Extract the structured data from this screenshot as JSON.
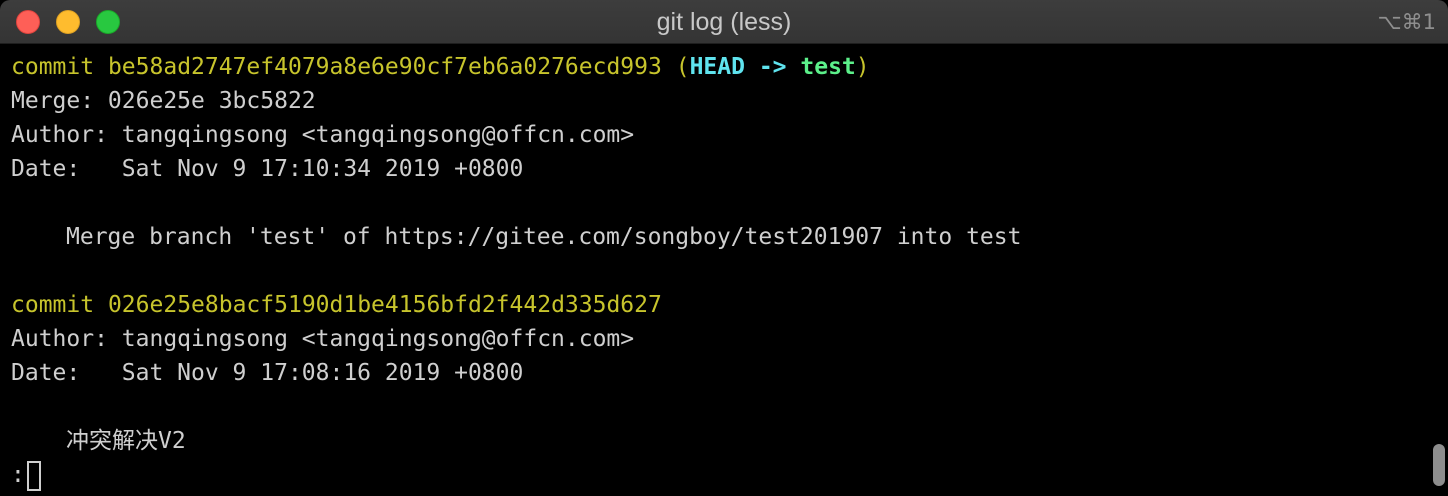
{
  "window": {
    "title": "git log (less)",
    "shortcut": "⌥⌘1"
  },
  "terminal": {
    "commit1": {
      "keyword": "commit",
      "hash": "be58ad2747ef4079a8e6e90cf7eb6a0276ecd993",
      "paren_open": "(",
      "head": "HEAD",
      "arrow": "->",
      "branch": "test",
      "paren_close": ")",
      "merge_line": "Merge: 026e25e 3bc5822",
      "author_line": "Author: tangqingsong <tangqingsong@offcn.com>",
      "date_line": "Date:   Sat Nov 9 17:10:34 2019 +0800",
      "message": "Merge branch 'test' of https://gitee.com/songboy/test201907 into test"
    },
    "commit2": {
      "keyword": "commit",
      "hash": "026e25e8bacf5190d1be4156bfd2f442d335d627",
      "author_line": "Author: tangqingsong <tangqingsong@offcn.com>",
      "date_line": "Date:   Sat Nov 9 17:08:16 2019 +0800",
      "message": "冲突解决V2"
    },
    "prompt": ":"
  },
  "colors": {
    "hash": "#c7c42c",
    "head": "#5fe3ee",
    "branch": "#5cf08a",
    "text": "#cfcfcf",
    "background": "#000000"
  }
}
